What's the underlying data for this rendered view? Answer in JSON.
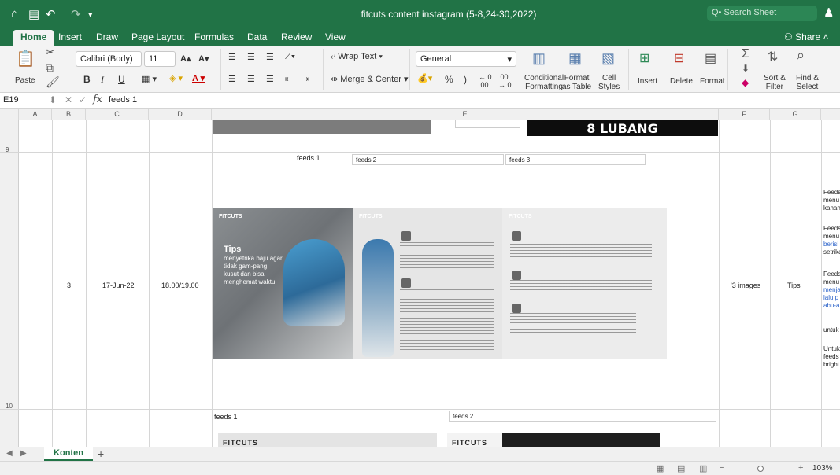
{
  "titlebar": {
    "title": "fitcuts content instagram (5-8,24-30,2022)",
    "search_placeholder": "Q• Search Sheet"
  },
  "tabs": [
    "Home",
    "Insert",
    "Draw",
    "Page Layout",
    "Formulas",
    "Data",
    "Review",
    "View"
  ],
  "share_label": "Share",
  "ribbon": {
    "paste": "Paste",
    "font_name": "Calibri (Body)",
    "font_size": "11",
    "bold": "B",
    "italic": "I",
    "underline": "U",
    "wrap_text": "Wrap Text",
    "merge_center": "Merge & Center",
    "number_format": "General",
    "percent": "%",
    "comma": ")",
    "conditional_formatting": "Conditional\nFormatting",
    "format_as_table": "Format\nas Table",
    "cell_styles": "Cell\nStyles",
    "insert": "Insert",
    "delete": "Delete",
    "format": "Format",
    "sort_filter": "Sort &\nFilter",
    "find_select": "Find &\nSelect"
  },
  "formula_bar": {
    "cell_ref": "E19",
    "fx": "fx",
    "content": "feeds 1"
  },
  "columns": [
    "A",
    "B",
    "C",
    "D",
    "E",
    "F",
    "G"
  ],
  "rows": {
    "r9": "9",
    "r10": "10",
    "row10": {
      "num": "3",
      "date": "17-Jun-22",
      "time": "18.00/19.00",
      "qty": "'3 images",
      "category": "Tips"
    }
  },
  "images": {
    "top_black_text": "8 LUBANG",
    "brand": "FITCUTS",
    "tips_title": "Tips",
    "tips_body": "menyetrika baju agar tidak gam-pang kusut dan bisa menghemat waktu",
    "bottom_brand": "FITCUTS"
  },
  "labels": {
    "feeds1_top": "feeds 1",
    "feeds2_top": "feeds 2",
    "feeds3_top": "feeds 3",
    "feeds1_bottom": "feeds 1",
    "feeds2_bottom": "feeds 2"
  },
  "side_notes": [
    {
      "text": "Feeds",
      "blue": false
    },
    {
      "text": "menu",
      "blue": false
    },
    {
      "text": "kanan",
      "blue": false
    },
    {
      "text": "Feeds",
      "blue": false
    },
    {
      "text": "menu",
      "blue": false
    },
    {
      "text": "berisi",
      "blue": true
    },
    {
      "text": "setrika",
      "blue": false
    },
    {
      "text": "Feeds",
      "blue": false
    },
    {
      "text": "menu",
      "blue": false
    },
    {
      "text": "menja",
      "blue": true
    },
    {
      "text": "lalu p",
      "blue": true
    },
    {
      "text": "abu-a",
      "blue": true
    },
    {
      "text": "untuk",
      "blue": false
    },
    {
      "text": "Untuk",
      "blue": false
    },
    {
      "text": "feeds",
      "blue": false
    },
    {
      "text": "bright",
      "blue": false
    }
  ],
  "sheet_tab": "Konten",
  "zoom": "103%",
  "colors": {
    "excel_green": "#217346",
    "link_blue": "#2c63c9"
  }
}
